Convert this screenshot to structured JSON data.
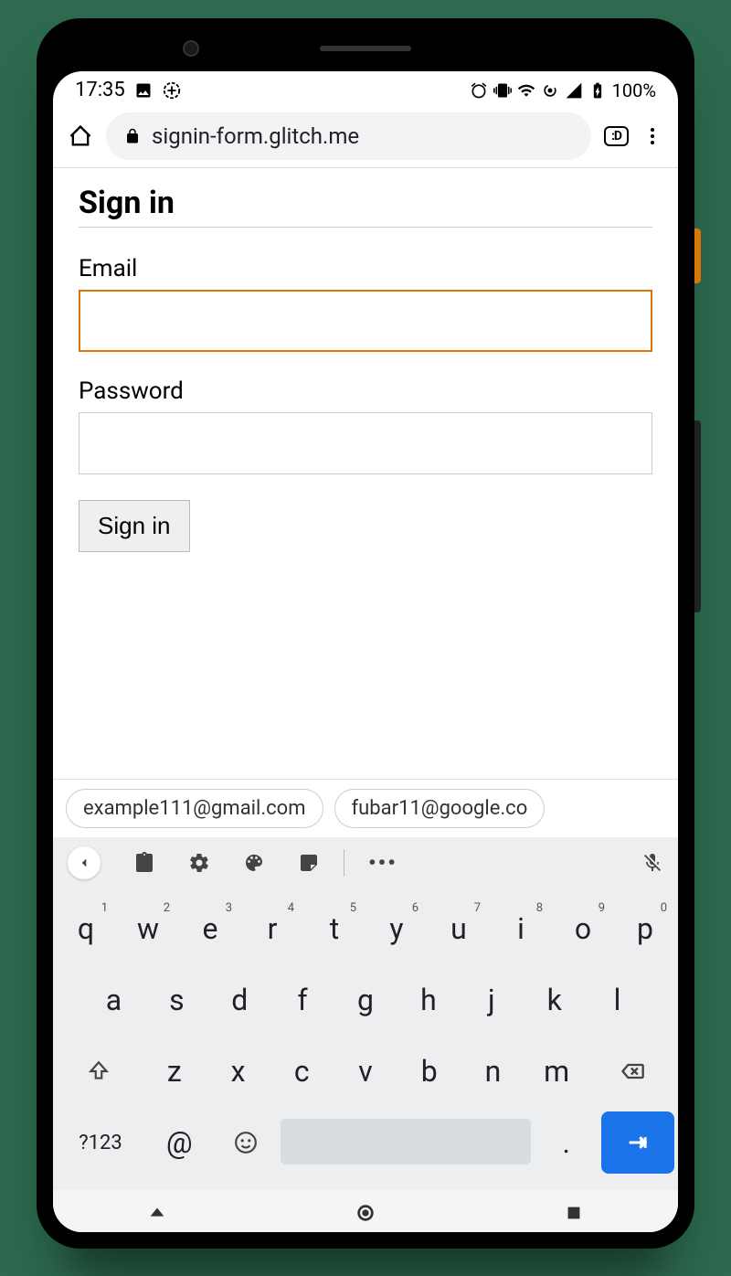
{
  "status": {
    "time": "17:35",
    "battery": "100%"
  },
  "browser": {
    "url": "signin-form.glitch.me",
    "tabs": ":D"
  },
  "page": {
    "title": "Sign in",
    "email_label": "Email",
    "password_label": "Password",
    "signin_button": "Sign in"
  },
  "suggestions": [
    "example111@gmail.com",
    "fubar11@google.co"
  ],
  "keyboard": {
    "row1": [
      {
        "k": "q",
        "n": "1"
      },
      {
        "k": "w",
        "n": "2"
      },
      {
        "k": "e",
        "n": "3"
      },
      {
        "k": "r",
        "n": "4"
      },
      {
        "k": "t",
        "n": "5"
      },
      {
        "k": "y",
        "n": "6"
      },
      {
        "k": "u",
        "n": "7"
      },
      {
        "k": "i",
        "n": "8"
      },
      {
        "k": "o",
        "n": "9"
      },
      {
        "k": "p",
        "n": "0"
      }
    ],
    "row2": [
      "a",
      "s",
      "d",
      "f",
      "g",
      "h",
      "j",
      "k",
      "l"
    ],
    "row3": [
      "z",
      "x",
      "c",
      "v",
      "b",
      "n",
      "m"
    ],
    "sym": "?123",
    "at": "@",
    "period": "."
  }
}
